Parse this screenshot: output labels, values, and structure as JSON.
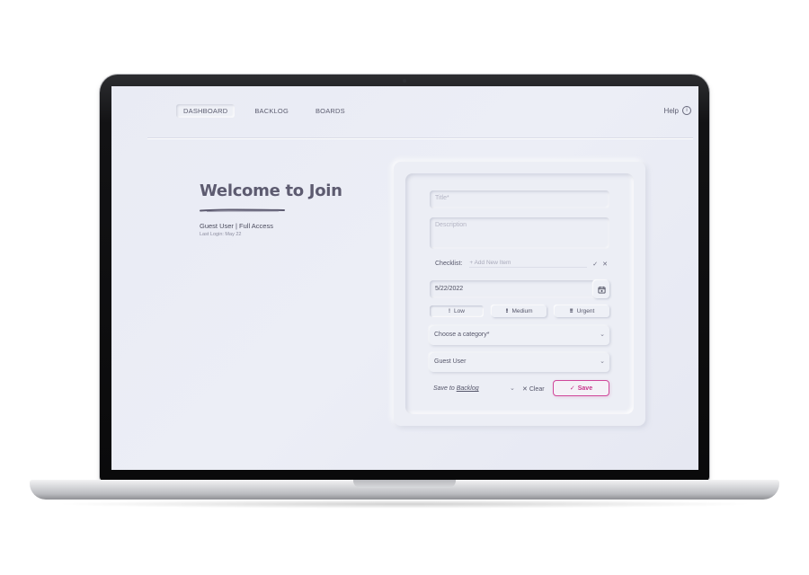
{
  "nav": {
    "tabs": [
      {
        "label": "DASHBOARD",
        "active": true
      },
      {
        "label": "BACKLOG",
        "active": false
      },
      {
        "label": "BOARDS",
        "active": false
      }
    ],
    "help_label": "Help",
    "help_icon": "info-icon"
  },
  "welcome": {
    "title": "Welcome to Join",
    "user_line": "Guest User | Full Access",
    "last_login": "Last Login: May 22"
  },
  "form": {
    "title_placeholder": "Title*",
    "description_placeholder": "Description",
    "checklist_label": "Checklist:",
    "checklist_placeholder": "+ Add New Item",
    "date_value": "5/22/2022",
    "priorities": [
      {
        "label": "Low",
        "icon": "!",
        "active": true
      },
      {
        "label": "Medium",
        "icon": "!!",
        "active": false
      },
      {
        "label": "Urgent",
        "icon": "!!!",
        "active": false
      }
    ],
    "category_placeholder": "Choose a category*",
    "assignee_value": "Guest User",
    "save_to_prefix": "Save to",
    "save_to_target": "Backlog",
    "clear_label": "Clear",
    "save_label": "Save"
  },
  "colors": {
    "accent": "#c8358d",
    "screen_bg": "#eceef5",
    "text": "#55566a"
  }
}
